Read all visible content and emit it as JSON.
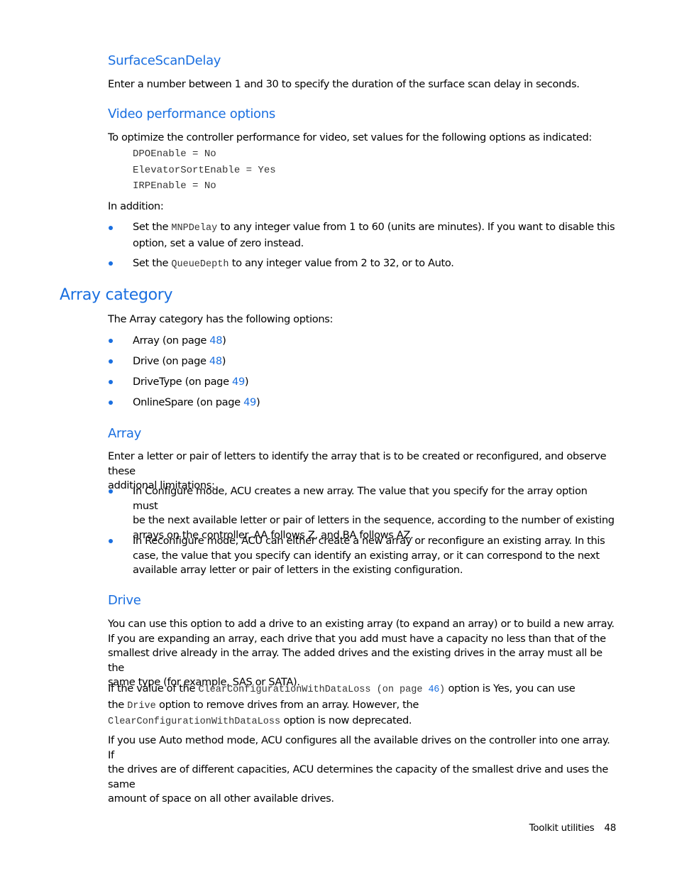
{
  "sections": {
    "surface_scan_delay": {
      "heading": "SurfaceScanDelay",
      "text": "Enter a number between 1 and 30 to specify the duration of the surface scan delay in seconds."
    },
    "video_performance": {
      "heading": "Video performance options",
      "intro": "To optimize the controller performance for video, set values for the following options as indicated:",
      "code_lines": [
        "DPOEnable = No",
        "ElevatorSortEnable = Yes",
        "IRPEnable = No"
      ],
      "in_addition": "In addition:",
      "bullets": [
        {
          "pre": "Set the ",
          "code": "MNPDelay",
          "post_line1": " to any integer value from 1 to 60 (units are minutes). If you want to disable this",
          "post_line2": "option, set a value of zero instead."
        },
        {
          "pre": "Set the ",
          "code": "QueueDepth",
          "post": " to any integer value from 2 to 32, or to Auto."
        }
      ]
    },
    "array_category": {
      "heading": "Array category",
      "intro": "The Array category has the following options:",
      "items": [
        {
          "label": "Array (on page ",
          "page": "48",
          "close": ")"
        },
        {
          "label": "Drive (on page ",
          "page": "48",
          "close": ")"
        },
        {
          "label": "DriveType (on page ",
          "page": "49",
          "close": ")"
        },
        {
          "label": "OnlineSpare (on page ",
          "page": "49",
          "close": ")"
        }
      ]
    },
    "array": {
      "heading": "Array",
      "intro_line1": "Enter a letter or pair of letters to identify the array that is to be created or reconfigured, and observe these",
      "intro_line2": "additional limitations:",
      "bullets": [
        {
          "lines": [
            "In Configure mode, ACU creates a new array. The value that you specify for the array option must",
            "be the next available letter or pair of letters in the sequence, according to the number of existing",
            "arrays on the controller. AA follows Z, and BA follows AZ."
          ]
        },
        {
          "lines": [
            "In Reconfigure mode, ACU can either create a new array or reconfigure an existing array. In this",
            "case, the value that you specify can identify an existing array, or it can correspond to the next",
            "available array letter or pair of letters in the existing configuration."
          ]
        }
      ]
    },
    "drive": {
      "heading": "Drive",
      "para1_lines": [
        "You can use this option to add a drive to an existing array (to expand an array) or to build a new array.",
        "If you are expanding an array, each drive that you add must have a capacity no less than that of the",
        "smallest drive already in the array. The added drives and the existing drives in the array must all be the",
        "same type (for example, SAS or SATA)."
      ],
      "para2": {
        "l1_pre": "If the value of the ",
        "l1_code": "ClearConfigurationWithDataLoss",
        "l1_ref_pre": " (on page ",
        "l1_ref_page": "46",
        "l1_ref_close": ")",
        "l1_post": " option is Yes, you can use",
        "l2_pre": "the ",
        "l2_code": "Drive",
        "l2_post": " option to remove drives from an array. However, the",
        "l3_code": "ClearConfigurationWithDataLoss",
        "l3_post": " option is now deprecated."
      },
      "para3_lines": [
        "If you use Auto method mode, ACU configures all the available drives on the controller into one array. If",
        "the drives are of different capacities, ACU determines the capacity of the smallest drive and uses the same",
        "amount of space on all other available drives."
      ]
    }
  },
  "footer": {
    "section": "Toolkit utilities",
    "page_number": "48"
  }
}
